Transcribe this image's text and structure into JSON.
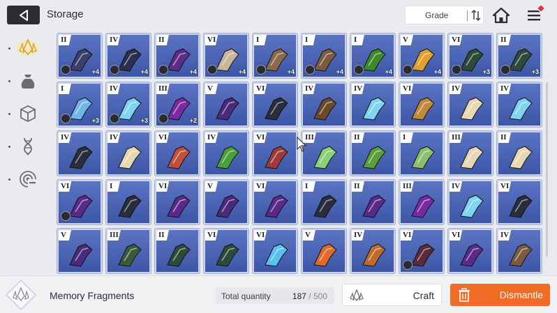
{
  "header": {
    "title": "Storage",
    "grade_label": "Grade"
  },
  "sidebar": {
    "items": [
      {
        "icon": "memory-fragment-icon",
        "selected": true
      },
      {
        "icon": "pouch-icon"
      },
      {
        "icon": "cube-icon"
      },
      {
        "icon": "dna-icon"
      },
      {
        "icon": "target-icon"
      }
    ]
  },
  "grid": {
    "rows": [
      [
        {
          "grade": "II",
          "level": "+4",
          "owner": true,
          "color": "#3a3f6b"
        },
        {
          "grade": "IV",
          "level": "+4",
          "owner": true,
          "color": "#2c2f4f"
        },
        {
          "grade": "II",
          "level": "+4",
          "owner": true,
          "color": "#5b2d86"
        },
        {
          "grade": "VI",
          "level": "+4",
          "owner": true,
          "color": "#c9b59a"
        },
        {
          "grade": "I",
          "level": "+4",
          "owner": true,
          "color": "#8a6a4a"
        },
        {
          "grade": "I",
          "level": "+4",
          "owner": true,
          "color": "#7d5b3e"
        },
        {
          "grade": "I",
          "level": "+4",
          "owner": true,
          "color": "#3a8a2a"
        },
        {
          "grade": "V",
          "level": "+4",
          "owner": true,
          "color": "#e0a030"
        },
        {
          "grade": "VI",
          "level": "+3",
          "owner": true,
          "color": "#2e4a3a"
        },
        {
          "grade": "II",
          "level": "+3",
          "owner": true,
          "color": "#2e4a3a"
        }
      ],
      [
        {
          "grade": "I",
          "level": "+3",
          "owner": true,
          "color": "#6fb5e8"
        },
        {
          "grade": "IV",
          "level": "+3",
          "owner": true,
          "color": "#7fd4f0"
        },
        {
          "grade": "III",
          "level": "+2",
          "owner": true,
          "color": "#7a2aa0"
        },
        {
          "grade": "V",
          "level": "",
          "owner": false,
          "color": "#4a2a7a"
        },
        {
          "grade": "VI",
          "level": "",
          "owner": false,
          "color": "#2a2d3a"
        },
        {
          "grade": "IV",
          "level": "",
          "owner": false,
          "color": "#6a4a2a"
        },
        {
          "grade": "IV",
          "level": "",
          "owner": false,
          "color": "#7fd4f0"
        },
        {
          "grade": "VI",
          "level": "",
          "owner": false,
          "color": "#c08a3a"
        },
        {
          "grade": "IV",
          "level": "",
          "owner": false,
          "color": "#e8d7b4"
        },
        {
          "grade": "IV",
          "level": "",
          "owner": false,
          "color": "#7fd4f0"
        }
      ],
      [
        {
          "grade": "IV",
          "level": "",
          "owner": false,
          "color": "#2a2d3a"
        },
        {
          "grade": "IV",
          "level": "",
          "owner": false,
          "color": "#e8d7b4"
        },
        {
          "grade": "VI",
          "level": "",
          "owner": false,
          "color": "#c0503a"
        },
        {
          "grade": "IV",
          "level": "",
          "owner": false,
          "color": "#4aa03a"
        },
        {
          "grade": "VI",
          "level": "",
          "owner": false,
          "color": "#a03a3a"
        },
        {
          "grade": "III",
          "level": "",
          "owner": false,
          "color": "#8ad07a"
        },
        {
          "grade": "II",
          "level": "",
          "owner": false,
          "color": "#5aa03a"
        },
        {
          "grade": "I",
          "level": "",
          "owner": false,
          "color": "#8ac06a"
        },
        {
          "grade": "III",
          "level": "",
          "owner": false,
          "color": "#e8d7b4"
        },
        {
          "grade": "II",
          "level": "",
          "owner": false,
          "color": "#e8d7b4"
        }
      ],
      [
        {
          "grade": "VI",
          "level": "",
          "owner": true,
          "color": "#5a2a8a"
        },
        {
          "grade": "I",
          "level": "",
          "owner": false,
          "color": "#2a2d3a"
        },
        {
          "grade": "VI",
          "level": "",
          "owner": false,
          "color": "#5a2a8a"
        },
        {
          "grade": "V",
          "level": "",
          "owner": false,
          "color": "#4a2a7a"
        },
        {
          "grade": "VI",
          "level": "",
          "owner": false,
          "color": "#5a2a8a"
        },
        {
          "grade": "I",
          "level": "",
          "owner": false,
          "color": "#2a2d3a"
        },
        {
          "grade": "II",
          "level": "",
          "owner": false,
          "color": "#5a2a8a"
        },
        {
          "grade": "III",
          "level": "",
          "owner": false,
          "color": "#7a2aa0"
        },
        {
          "grade": "IV",
          "level": "",
          "owner": false,
          "color": "#7fd4f0"
        },
        {
          "grade": "VI",
          "level": "",
          "owner": false,
          "color": "#2a2d3a"
        }
      ],
      [
        {
          "grade": "V",
          "level": "",
          "owner": false,
          "color": "#4a2a7a"
        },
        {
          "grade": "III",
          "level": "",
          "owner": false,
          "color": "#3a5a3a"
        },
        {
          "grade": "II",
          "level": "",
          "owner": false,
          "color": "#2e4a3a"
        },
        {
          "grade": "VI",
          "level": "",
          "owner": false,
          "color": "#2e4a3a"
        },
        {
          "grade": "VI",
          "level": "",
          "owner": false,
          "color": "#5ac0f0"
        },
        {
          "grade": "V",
          "level": "",
          "owner": false,
          "color": "#e06a2a"
        },
        {
          "grade": "IV",
          "level": "",
          "owner": false,
          "color": "#c06a2a"
        },
        {
          "grade": "VI",
          "level": "",
          "owner": true,
          "color": "#5a2a3a"
        },
        {
          "grade": "VI",
          "level": "",
          "owner": false,
          "color": "#5a2a8a"
        },
        {
          "grade": "IV",
          "level": "",
          "owner": false,
          "color": "#7d5b3e"
        }
      ]
    ]
  },
  "footer": {
    "fragments_label": "Memory Fragments",
    "total_label": "Total quantity",
    "total_value": "187",
    "total_max": "/ 500",
    "craft_label": "Craft",
    "dismantle_label": "Dismantle"
  },
  "colors": {
    "accent": "#f06b25",
    "cell_bg": "#4a63b3",
    "dark": "#2b2d31"
  }
}
